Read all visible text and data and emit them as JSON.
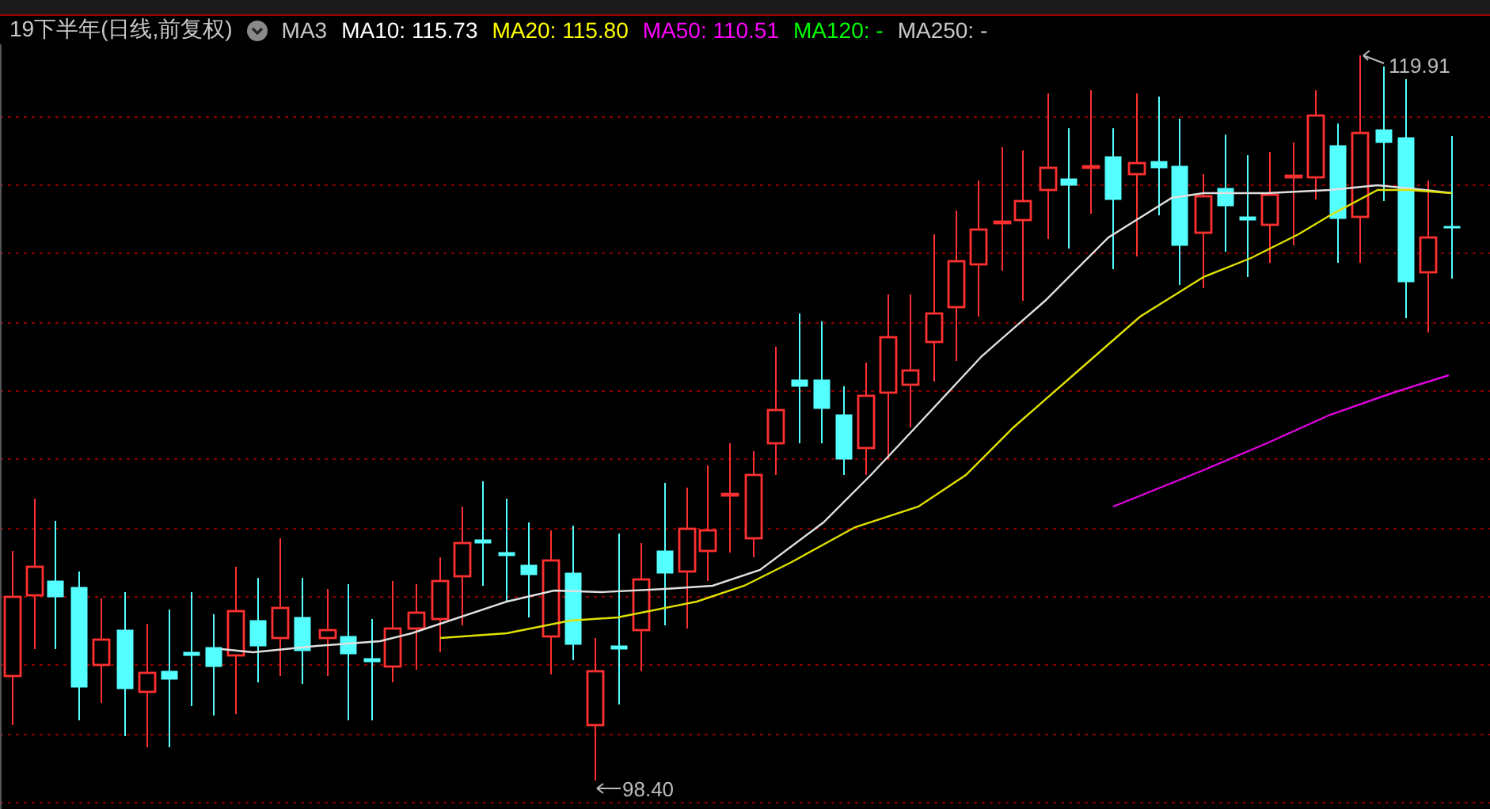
{
  "header": {
    "title": "19下半年(日线,前复权)",
    "indicators": [
      {
        "label": "MA3",
        "color": "#c8c8c8"
      },
      {
        "label": "MA10: 115.73",
        "color": "#ffffff"
      },
      {
        "label": "MA20: 115.80",
        "color": "#ffff00"
      },
      {
        "label": "MA50: 110.51",
        "color": "#ff00ff"
      },
      {
        "label": "MA120: -",
        "color": "#00ff00"
      },
      {
        "label": "MA250: -",
        "color": "#c8c8c8"
      }
    ]
  },
  "chart": {
    "high_label": "119.91",
    "low_label": "98.40"
  }
}
